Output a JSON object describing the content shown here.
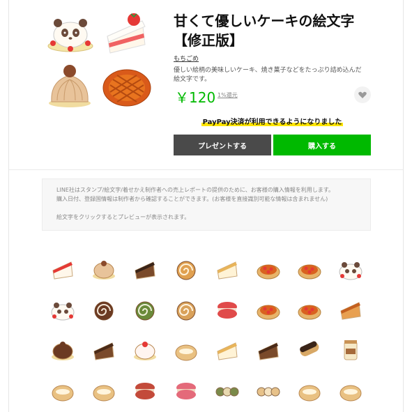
{
  "product": {
    "title_line1": "甘くて優しいケーキの絵文字",
    "title_line2": "【修正版】",
    "author": "もちごめ",
    "description_line1": "優しい絵柄の美味しいケーキ、焼き菓子などをたっぷり詰め込んだ",
    "description_line2": "絵文字です。",
    "price": "￥120",
    "points": "1%還元",
    "favorite_icon": "heart-icon",
    "hero_icons": [
      "panda-cake-icon",
      "strawberry-shortcake-icon",
      "mont-blanc-icon",
      "apple-pie-icon"
    ]
  },
  "promo": {
    "paypay": "PayPay決済が利用できるようになりました"
  },
  "buttons": {
    "gift": "プレゼントする",
    "buy": "購入する"
  },
  "notice": {
    "line1": "LINE社はスタンプ/絵文字/着せかえ制作者への売上レポートの提供のために、お客様の購入情報を利用します。",
    "line2": "購入日付、登録国情報は制作者から確認することができます。(お客様を直接識別可能な情報は含まれません)",
    "line3": "絵文字をクリックするとプレビューが表示されます。"
  },
  "emoji_grid": [
    "strawberry-shortcake-icon",
    "mont-blanc-icon",
    "tiramisu-icon",
    "roll-cake-slice-icon",
    "cheesecake-slice-icon",
    "apple-pie-icon",
    "strawberry-tart-icon",
    "panda-cake-icon",
    "panda-cake-slice-icon",
    "chocolate-roll-icon",
    "matcha-roll-icon",
    "swiss-roll-icon",
    "macaron-icon",
    "fruit-tart-slice-icon",
    "strawberry-tart-slice-icon",
    "pie-slice-icon",
    "chocolate-mousse-icon",
    "chocolate-cake-slice-icon",
    "fruit-shortcake-icon",
    "cream-puff-icon",
    "cheese-cake-icon",
    "cheesecake-chocolate-icon",
    "eclair-icon",
    "pudding-jar-icon",
    "custard-choux-icon",
    "choux-cream-icon",
    "macaron-stack-icon",
    "pink-macaron-stack-icon",
    "mini-roll-set-icon",
    "mini-choux-set-icon",
    "baked-choux-icon",
    "fluffy-choux-icon"
  ],
  "colors": {
    "accent_green": "#00b900",
    "gift_button": "#4a4a4a",
    "paypay_highlight": "#ffe600"
  }
}
